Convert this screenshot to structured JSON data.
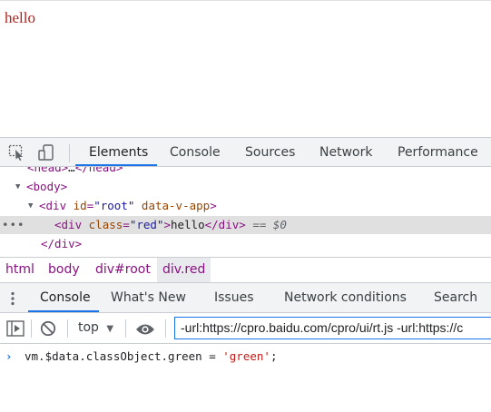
{
  "page": {
    "text": "hello"
  },
  "devtools": {
    "tabs": [
      "Elements",
      "Console",
      "Sources",
      "Network",
      "Performance"
    ],
    "active_tab": "Elements",
    "icons": [
      "inspect-element-icon",
      "device-toolbar-icon"
    ]
  },
  "dom": {
    "line0": {
      "open": "<head>",
      "ellipsis": "…",
      "close": "</head>"
    },
    "line1": {
      "tag": "<body>"
    },
    "line2": {
      "tag_open": "<div",
      "attr1": "id",
      "val1": "\"root\"",
      "attr2": "data-v-app",
      "tag_close": ">"
    },
    "line3": {
      "tag_open": "<div",
      "attr": "class",
      "val": "\"red\"",
      "gt": ">",
      "text": "hello",
      "end_tag": "</div>",
      "eq": "== $0"
    },
    "line4": {
      "tag": "</div>"
    },
    "selected_dots": "•••"
  },
  "breadcrumb": [
    "html",
    "body",
    "div#root",
    "div.red"
  ],
  "drawer": {
    "tabs": [
      "Console",
      "What's New",
      "Issues",
      "Network conditions",
      "Search"
    ],
    "active_tab": "Console"
  },
  "console": {
    "context": "top",
    "filter_value": "-url:https://cpro.baidu.com/cpro/ui/rt.js -url:https://c",
    "prompt": {
      "code_prefix": "vm.$data.classObject.green = ",
      "string": "'green'",
      "suffix": ";"
    }
  },
  "colors": {
    "accent": "#1a73e8",
    "tag": "#881280",
    "attr": "#994500",
    "value": "#1a1aa6",
    "page_text": "#b4221b"
  }
}
